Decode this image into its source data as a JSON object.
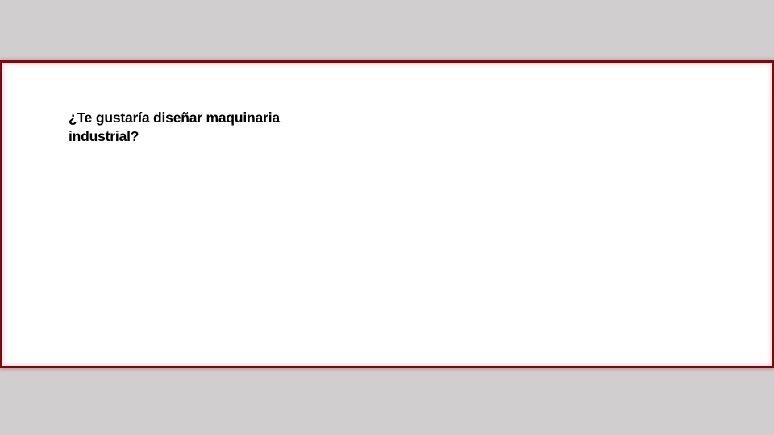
{
  "banner": {
    "title": "¿Te gustaría diseñar maquinaria industrial?",
    "border_color": "#7a0a12",
    "background_color": "#ffffff"
  },
  "page": {
    "background_color": "#d0cece"
  }
}
